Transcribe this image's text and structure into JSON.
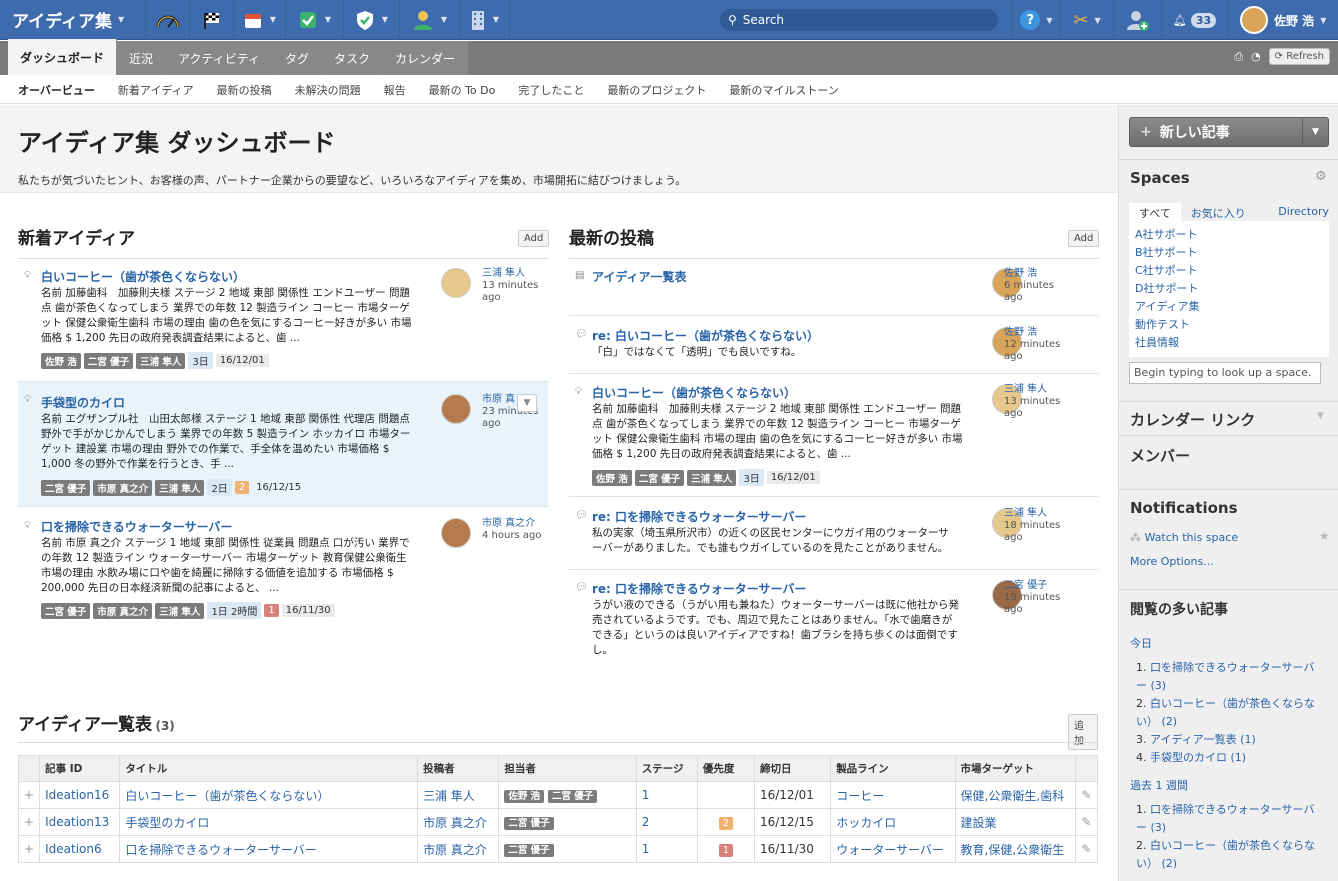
{
  "topbar": {
    "app_title": "アイディア集",
    "search_placeholder": "Search",
    "notif_count": "33",
    "user_name": "佐野 浩"
  },
  "tabs": [
    "ダッシュボード",
    "近況",
    "アクティビティ",
    "タグ",
    "タスク",
    "カレンダー"
  ],
  "refresh_label": "Refresh",
  "subnav": [
    "オーバービュー",
    "新着アイディア",
    "最新の投稿",
    "未解決の問題",
    "報告",
    "最新の To Do",
    "完了したこと",
    "最新のプロジェクト",
    "最新のマイルストーン"
  ],
  "header": {
    "title": "アイディア集 ダッシュボード",
    "description": "私たちが気づいたヒント、お客様の声、パートナー企業からの要望など、いろいろなアイディアを集め、市場開拓に結びつけましょう。"
  },
  "new_ideas": {
    "title": "新着アイディア",
    "add_label": "Add",
    "items": [
      {
        "title": "白いコーヒー（歯が茶色くならない）",
        "body": [
          "名前 加藤歯科　加藤則夫様 ステージ 2 地域 東部 関係性 エンドユーザー 問題",
          "点 歯が茶色くなってしまう 業界での年数 12 製造ライン コーヒー 市場ターゲ",
          "ット 保健公衆衛生歯科 市場の理由 歯の色を気にするコーヒー好きが多い 市場",
          "価格 $ 1,200 先日の政府発表調査結果によると、歯 ..."
        ],
        "tags": [
          "佐野 浩",
          "二宮 優子",
          "三浦 隼人"
        ],
        "meta": "3日",
        "count": "",
        "date": "16/12/01",
        "author": "三浦 隼人",
        "time": [
          "13 minutes",
          "ago"
        ]
      },
      {
        "title": "手袋型のカイロ",
        "body": [
          "名前 エグザンプル社　山田太郎様 ステージ 1 地域 東部 関係性 代理店 問題点",
          "野外で手がかじかんでしまう 業界での年数 5 製造ライン ホッカイロ 市場ター",
          "ゲット 建設業 市場の理由 野外での作業で、手全体を温めたい 市場価格 $",
          "1,000 冬の野外で作業を行うとき、手 ..."
        ],
        "tags": [
          "二宮 優子",
          "市原 真之介",
          "三浦 隼人"
        ],
        "meta": "2日",
        "count": "2",
        "date": "16/12/15",
        "author": "市原 真",
        "time": [
          "23 minutes",
          "ago"
        ]
      },
      {
        "title": "口を掃除できるウォーターサーバー",
        "body": [
          "名前 市原 真之介 ステージ 1 地域 東部 関係性 従業員 問題点 口が汚い 業界で",
          "の年数 12 製造ライン ウォーターサーバー 市場ターゲット 教育保健公衆衛生",
          "市場の理由 水飲み場に口や歯を綺麗に掃除する価値を追加する 市場価格 $",
          "200,000 先日の日本経済新聞の記事によると、 ..."
        ],
        "tags": [
          "二宮 優子",
          "市原 真之介",
          "三浦 隼人"
        ],
        "meta": "1日 2時間",
        "count": "1",
        "date": "16/11/30",
        "author": "市原 真之介",
        "time": [
          "4 hours ago"
        ]
      }
    ]
  },
  "recent_posts": {
    "title": "最新の投稿",
    "add_label": "Add",
    "items": [
      {
        "title": "アイディア一覧表",
        "body": [],
        "author": "佐野 浩",
        "time": [
          "6 minutes",
          "ago"
        ]
      },
      {
        "title": "re: 白いコーヒー（歯が茶色くならない）",
        "body": [
          "「白」ではなくて「透明」でも良いですね。"
        ],
        "author": "佐野 浩",
        "time": [
          "12 minutes",
          "ago"
        ]
      },
      {
        "title": "白いコーヒー（歯が茶色くならない）",
        "body": [
          "名前 加藤歯科　加藤則夫様 ステージ 2 地域 東部 関係性 エンドユーザー 問題",
          "点 歯が茶色くなってしまう 業界での年数 12 製造ライン コーヒー 市場ターゲ",
          "ット 保健公衆衛生歯科 市場の理由 歯の色を気にするコーヒー好きが多い 市場",
          "価格 $ 1,200 先日の政府発表調査結果によると、歯 ..."
        ],
        "author": "三浦 隼人",
        "time": [
          "13 minutes",
          "ago"
        ]
      },
      {
        "title": "re: 口を掃除できるウォーターサーバー",
        "body": [
          "私の実家（埼玉県所沢市）の近くの区民センターにウガイ用のウォーターサ",
          "ーバーがありました。でも誰もウガイしているのを見たことがありません。"
        ],
        "author": "三浦 隼人",
        "time": [
          "18 minutes",
          "ago"
        ]
      },
      {
        "title": "re: 口を掃除できるウォーターサーバー",
        "body": [
          "うがい液のできる（うがい用も兼ねた）ウォーターサーバーは既に他社から発",
          "売されているようです。でも、周辺で見たことはありません。「水で歯磨きが",
          "できる」というのは良いアイディアですね！歯ブラシを持ち歩くのは面倒です",
          "し。"
        ],
        "author": "二宮 優子",
        "time": [
          "19 minutes",
          "ago"
        ]
      }
    ],
    "post3_tags": [
      "佐野 浩",
      "二宮 優子",
      "三浦 隼人"
    ],
    "post3_meta": "3日",
    "post3_date": "16/12/01"
  },
  "idea_table": {
    "title": "アイディア一覧表",
    "count": "(3)",
    "add_label": "追加",
    "columns": [
      "記事 ID",
      "タイトル",
      "投稿者",
      "担当者",
      "ステージ",
      "優先度",
      "締切日",
      "製品ライン",
      "市場ターゲット"
    ],
    "rows": [
      {
        "id": "Ideation16",
        "title": "白いコーヒー（歯が茶色くならない）",
        "poster": "三浦 隼人",
        "assignees": [
          "佐野 浩",
          "二宮 優子"
        ],
        "stage": "1",
        "priority": "",
        "deadline": "16/12/01",
        "product": "コーヒー",
        "target": "保健,公衆衛生,歯科"
      },
      {
        "id": "Ideation13",
        "title": "手袋型のカイロ",
        "poster": "市原 真之介",
        "assignees": [
          "二宮 優子"
        ],
        "stage": "2",
        "priority": "2",
        "deadline": "16/12/15",
        "product": "ホッカイロ",
        "target": "建設業"
      },
      {
        "id": "Ideation6",
        "title": "口を掃除できるウォーターサーバー",
        "poster": "市原 真之介",
        "assignees": [
          "二宮 優子"
        ],
        "stage": "1",
        "priority": "1",
        "deadline": "16/11/30",
        "product": "ウォーターサーバー",
        "target": "教育,保健,公衆衛生"
      }
    ]
  },
  "sidebar": {
    "new_post_label": "新しい記事",
    "spaces_title": "Spaces",
    "space_tabs": [
      "すべて",
      "お気に入り",
      "Directory"
    ],
    "spaces": [
      "A社サポート",
      "B社サポート",
      "C社サポート",
      "D社サポート",
      "アイディア集",
      "動作テスト",
      "社員情報"
    ],
    "lookup_placeholder": "Begin typing to look up a space.",
    "calendar_links": "カレンダー リンク",
    "members": "メンバー",
    "notifications": "Notifications",
    "watch": "Watch this space",
    "more_options": "More Options...",
    "popular_title": "閲覧の多い記事",
    "today": "今日",
    "today_items": [
      "口を掃除できるウォーターサーバー (3)",
      "白いコーヒー（歯が茶色くならない） (2)",
      "アイディア一覧表 (1)",
      "手袋型のカイロ (1)"
    ],
    "week": "過去 1 週間",
    "week_items": [
      "口を掃除できるウォーターサーバー (3)",
      "白いコーヒー（歯が茶色くならない） (2)"
    ]
  },
  "colors": {
    "topbar": "#3e6bae",
    "link": "#2a64a8",
    "count_orange": "#f0b070",
    "count_red": "#d9827c",
    "highlight": "#e8f3fb"
  }
}
